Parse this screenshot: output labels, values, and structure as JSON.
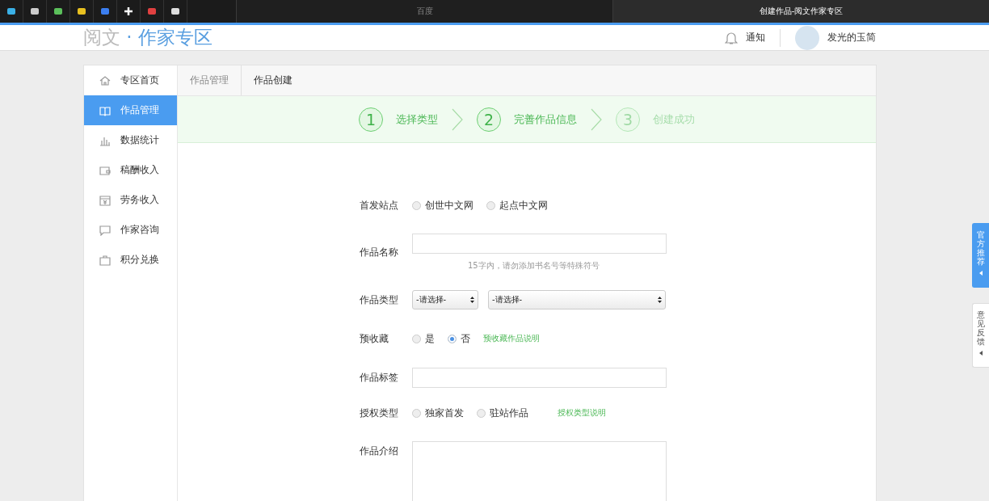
{
  "browser": {
    "tabs": [
      {
        "title": "百度",
        "selected": false
      },
      {
        "title": "创建作品-阅文作家专区",
        "selected": true
      }
    ]
  },
  "header": {
    "brand": "阅文",
    "section": "· 作家专区",
    "notice": "通知",
    "user": "发光的玉简"
  },
  "sidebar": {
    "items": [
      {
        "label": "专区首页",
        "selected": false
      },
      {
        "label": "作品管理",
        "selected": true
      },
      {
        "label": "数据统计",
        "selected": false
      },
      {
        "label": "稿酬收入",
        "selected": false
      },
      {
        "label": "劳务收入",
        "selected": false
      },
      {
        "label": "作家咨询",
        "selected": false
      },
      {
        "label": "积分兑换",
        "selected": false
      }
    ]
  },
  "breadcrumb": [
    "作品管理",
    "作品创建"
  ],
  "steps": [
    {
      "number": "1",
      "label": "选择类型",
      "active": true
    },
    {
      "number": "2",
      "label": "完善作品信息",
      "active": true
    },
    {
      "number": "3",
      "label": "创建成功",
      "active": false
    }
  ],
  "form": [
    {
      "kind": "radio",
      "label": "首发站点",
      "options": [
        {
          "label": "创世中文网",
          "selected": false
        },
        {
          "label": "起点中文网",
          "selected": false
        }
      ]
    },
    {
      "kind": "text",
      "label": "作品名称",
      "hint": "15字内，请勿添加书名号等特殊符号"
    },
    {
      "kind": "select",
      "label": "作品类型",
      "selects": [
        "-请选择-",
        "-请选择-"
      ]
    },
    {
      "kind": "radio",
      "label": "预收藏",
      "options": [
        {
          "label": "是",
          "selected": false
        },
        {
          "label": "否",
          "selected": true
        }
      ],
      "link": "预收藏作品说明"
    },
    {
      "kind": "text",
      "label": "作品标签"
    },
    {
      "kind": "radio",
      "label": "授权类型",
      "options": [
        {
          "label": "独家首发",
          "selected": false
        },
        {
          "label": "驻站作品",
          "selected": false
        }
      ],
      "link": "授权类型说明"
    },
    {
      "kind": "textarea",
      "label": "作品介绍"
    }
  ],
  "side_tabs": [
    {
      "label": "官方推荐",
      "highlighted": true
    },
    {
      "label": "意见反馈",
      "highlighted": false
    }
  ]
}
